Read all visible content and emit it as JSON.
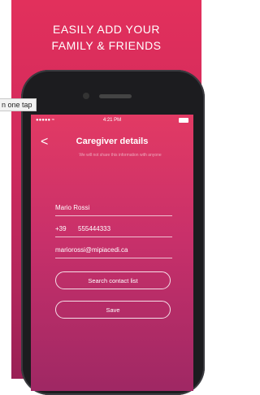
{
  "headline": {
    "line1": "EASILY ADD YOUR",
    "line2": "FAMILY & FRIENDS"
  },
  "tooltip": {
    "text": "n one tap"
  },
  "phone": {
    "status_left": "●●●●● ≈",
    "status_time": "4:21 PM"
  },
  "screen": {
    "back_label": "<",
    "title": "Caregiver details",
    "subtitle": "We will not share this information with anyone",
    "form": {
      "name_value": "Mario Rossi",
      "phone_prefix": "+39",
      "phone_value": "555444333",
      "email_value": "mariorossi@mipiacedi.ca"
    },
    "buttons": {
      "search_label": "Search contact list",
      "save_label": "Save"
    }
  },
  "colors": {
    "accent": "#d12a5d",
    "accent_dark": "#992055"
  }
}
